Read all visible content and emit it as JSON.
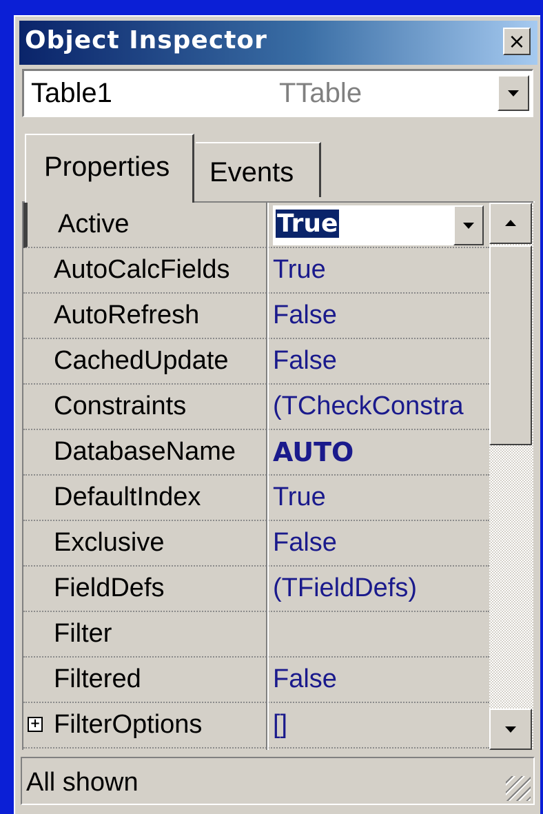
{
  "window": {
    "title": "Object Inspector",
    "close_glyph": "×"
  },
  "component_selector": {
    "name": "Table1",
    "type": "TTable"
  },
  "tabs": [
    {
      "label": "Properties",
      "active": true
    },
    {
      "label": "Events",
      "active": false
    }
  ],
  "properties": [
    {
      "name": "Active",
      "value": "True",
      "selected": true
    },
    {
      "name": "AutoCalcFields",
      "value": "True"
    },
    {
      "name": "AutoRefresh",
      "value": "False"
    },
    {
      "name": "CachedUpdate",
      "value": "False"
    },
    {
      "name": "Constraints",
      "value": "(TCheckConstra"
    },
    {
      "name": "DatabaseName",
      "value": "AUTO",
      "bold": true
    },
    {
      "name": "DefaultIndex",
      "value": "True"
    },
    {
      "name": "Exclusive",
      "value": "False"
    },
    {
      "name": "FieldDefs",
      "value": "(TFieldDefs)"
    },
    {
      "name": "Filter",
      "value": ""
    },
    {
      "name": "Filtered",
      "value": "False"
    },
    {
      "name": "FilterOptions",
      "value": "[]",
      "expandable": true,
      "expander_glyph": "+"
    }
  ],
  "status": {
    "text": "All shown"
  },
  "colors": {
    "background": "#0b1fd6",
    "face": "#d4d0c8",
    "title_start": "#0a246a",
    "value_text": "#1a1a8c",
    "selection": "#0a246a"
  },
  "icons": {
    "close": "close-icon",
    "dropdown": "chevron-down-icon",
    "scroll_up": "arrow-up-icon",
    "scroll_down": "arrow-down-icon",
    "expand": "plus-box-icon",
    "resize": "resize-grip-icon"
  }
}
